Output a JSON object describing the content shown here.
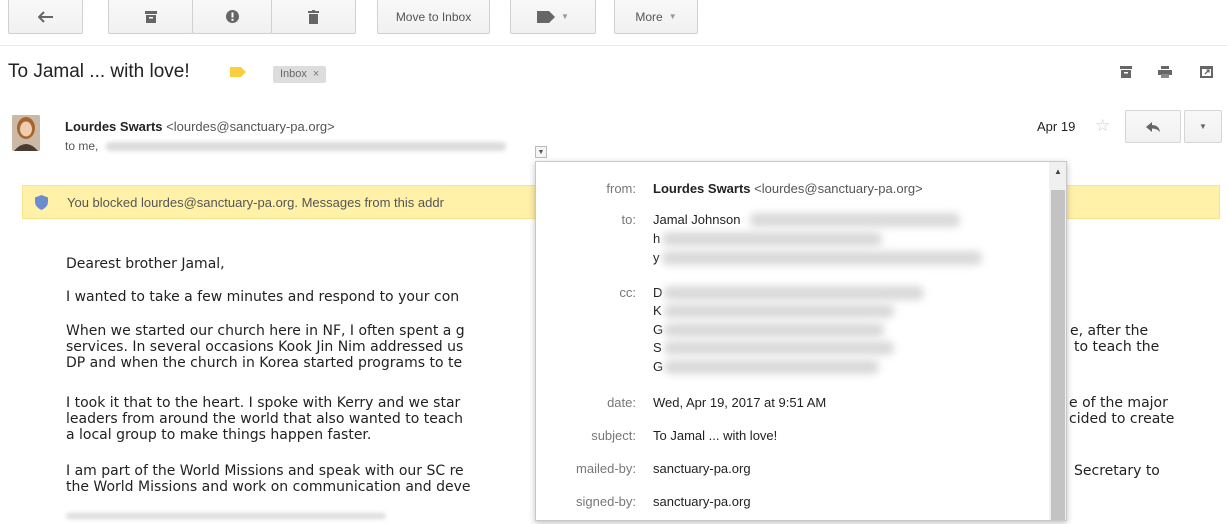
{
  "toolbar": {
    "back_icon": "back-arrow-icon",
    "archive_icon": "archive-icon",
    "spam_icon": "report-spam-icon",
    "delete_icon": "trash-icon",
    "move_to_inbox": "Move to Inbox",
    "labels_icon": "label-tag-icon",
    "more": "More"
  },
  "subject": {
    "title": "To Jamal ... with love!",
    "label_chip": "Inbox",
    "label_chip_close": "×",
    "label_color": "#f9cf3d"
  },
  "top_actions": [
    "archive-all-icon",
    "print-icon",
    "new-window-icon"
  ],
  "message": {
    "sender_name": "Lourdes Swarts",
    "sender_email": "<lourdes@sanctuary-pa.org>",
    "to_line": "to me,",
    "date": "Apr 19",
    "star": "☆"
  },
  "warning": {
    "text": "You blocked lourdes@sanctuary-pa.org. Messages from this addr"
  },
  "body": {
    "greeting": "Dearest brother Jamal,",
    "p1": "I wanted to take a few minutes and respond to your con",
    "p2_l1": "When we started our church here in NF, I often spent a g",
    "p2_l2": "services.  In several occasions Kook Jin Nim addressed us",
    "p2_l3": "DP and when the church in Korea started programs to te",
    "p2_r1": "e, after the",
    "p2_r2": "to teach the",
    "p3_l1": "I took it that to the heart. I spoke with Kerry and we star",
    "p3_l2": "leaders from around the world that also wanted to teach",
    "p3_l3": "a local group to make things happen faster.",
    "p3_r1": "e of the major",
    "p3_r2": "cided to create",
    "p4_l1": "I am part of the World Missions and speak with our SC re",
    "p4_l2": "the World Missions and work on communication and deve",
    "p4_r1": "Secretary to"
  },
  "details": {
    "from_label": "from:",
    "from_name": "Lourdes Swarts",
    "from_email": "<lourdes@sanctuary-pa.org>",
    "to_label": "to:",
    "to_first": "Jamal Johnson",
    "to_rest": [
      "h",
      "y"
    ],
    "cc_label": "cc:",
    "cc_initials": [
      "D",
      "K",
      "G",
      "S",
      "G"
    ],
    "date_label": "date:",
    "date_value": "Wed, Apr 19, 2017 at 9:51 AM",
    "subject_label": "subject:",
    "subject_value": "To Jamal ... with love!",
    "mailed_by_label": "mailed-by:",
    "mailed_by_value": "sanctuary-pa.org",
    "signed_by_label": "signed-by:",
    "signed_by_value": "sanctuary-pa.org"
  }
}
